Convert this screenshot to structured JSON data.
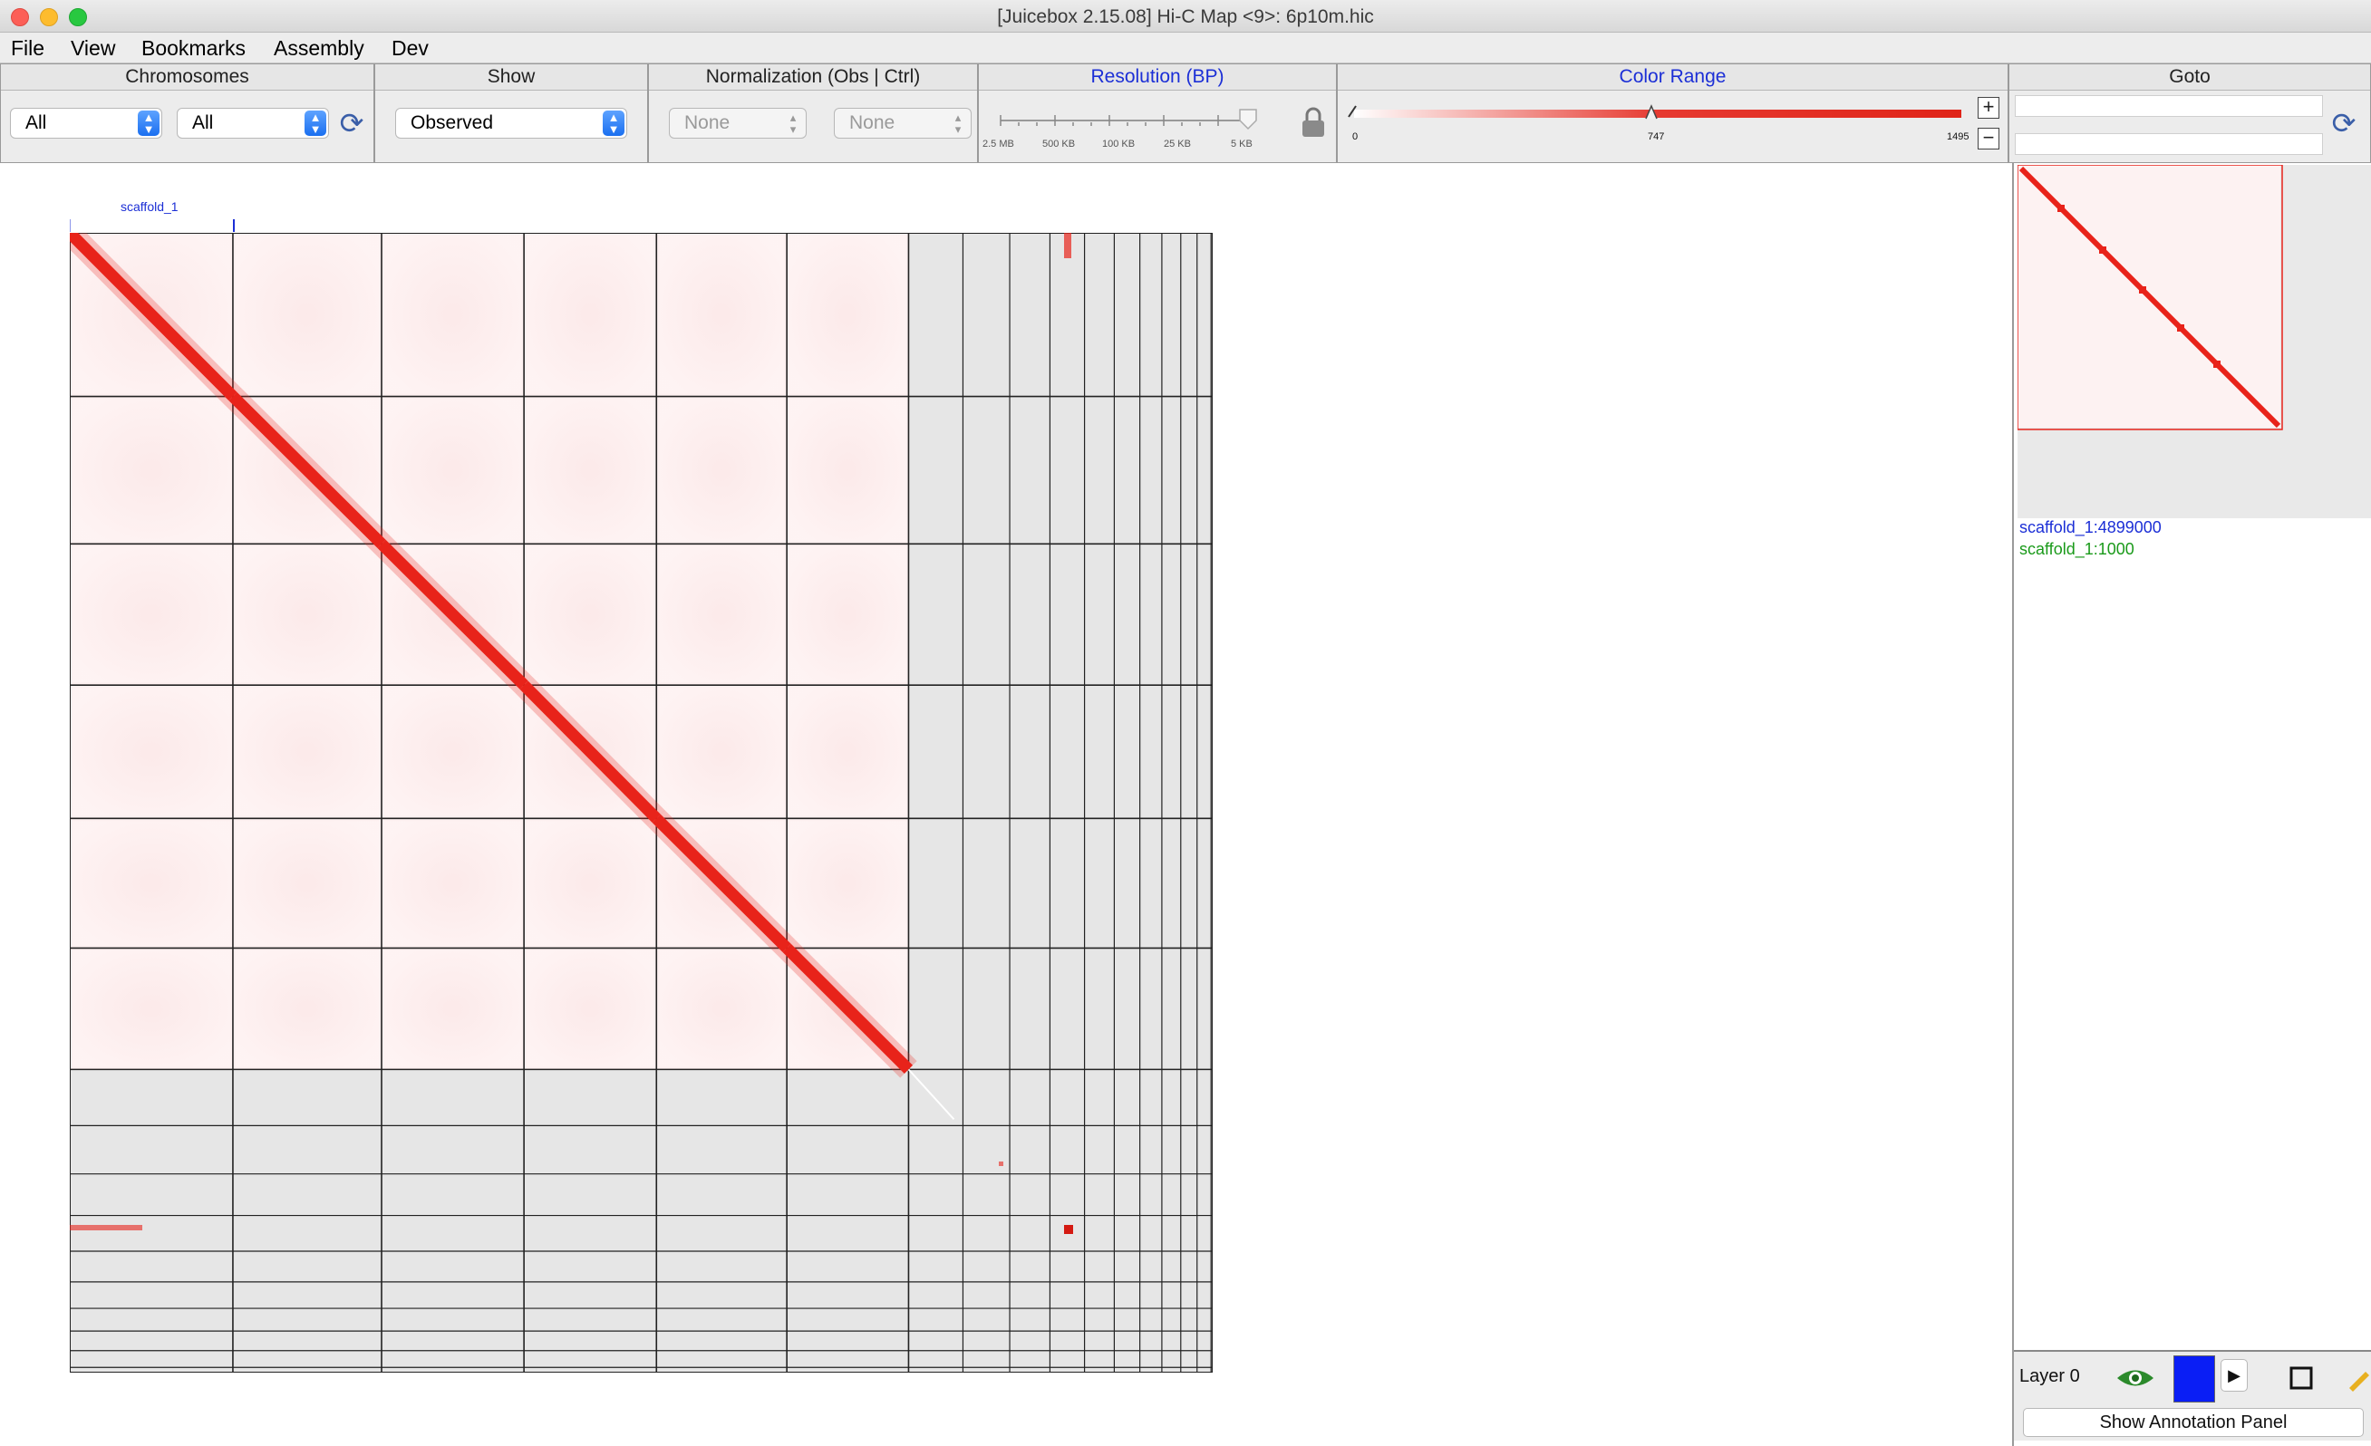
{
  "window": {
    "title": "[Juicebox 2.15.08] Hi-C Map <9>: 6p10m.hic"
  },
  "menu": [
    "File",
    "View",
    "Bookmarks",
    "Assembly",
    "Dev"
  ],
  "chromosomes": {
    "header": "Chromosomes",
    "chrom1": "All",
    "chrom2": "All",
    "refresh_icon": "refresh-icon"
  },
  "show": {
    "header": "Show",
    "value": "Observed"
  },
  "normalization": {
    "header": "Normalization  (Obs  |  Ctrl)",
    "obs": "None",
    "ctrl": "None"
  },
  "resolution": {
    "header": "Resolution (BP)",
    "ticks": [
      "2.5 MB",
      "500 KB",
      "100 KB",
      "25 KB",
      "5 KB"
    ],
    "selected_fraction": 1.0
  },
  "color_range": {
    "header": "Color Range",
    "min": "0",
    "mid": "747",
    "max": "1495",
    "plus": "+",
    "minus": "−"
  },
  "goto": {
    "header": "Goto",
    "field1": "",
    "field2": ""
  },
  "map": {
    "ruler_label": "scaffold_1",
    "accent": "#e8231a",
    "background_tint": "#fdf0f0",
    "blank_color": "#e6e6e6",
    "grid_color": "#222222"
  },
  "sidebar": {
    "position_1": "scaffold_1:4899000",
    "position_2": "scaffold_1:1000",
    "layer_label": "Layer 0",
    "layer_color": "#0a1ef5",
    "show_annotation_panel": "Show Annotation Panel"
  }
}
